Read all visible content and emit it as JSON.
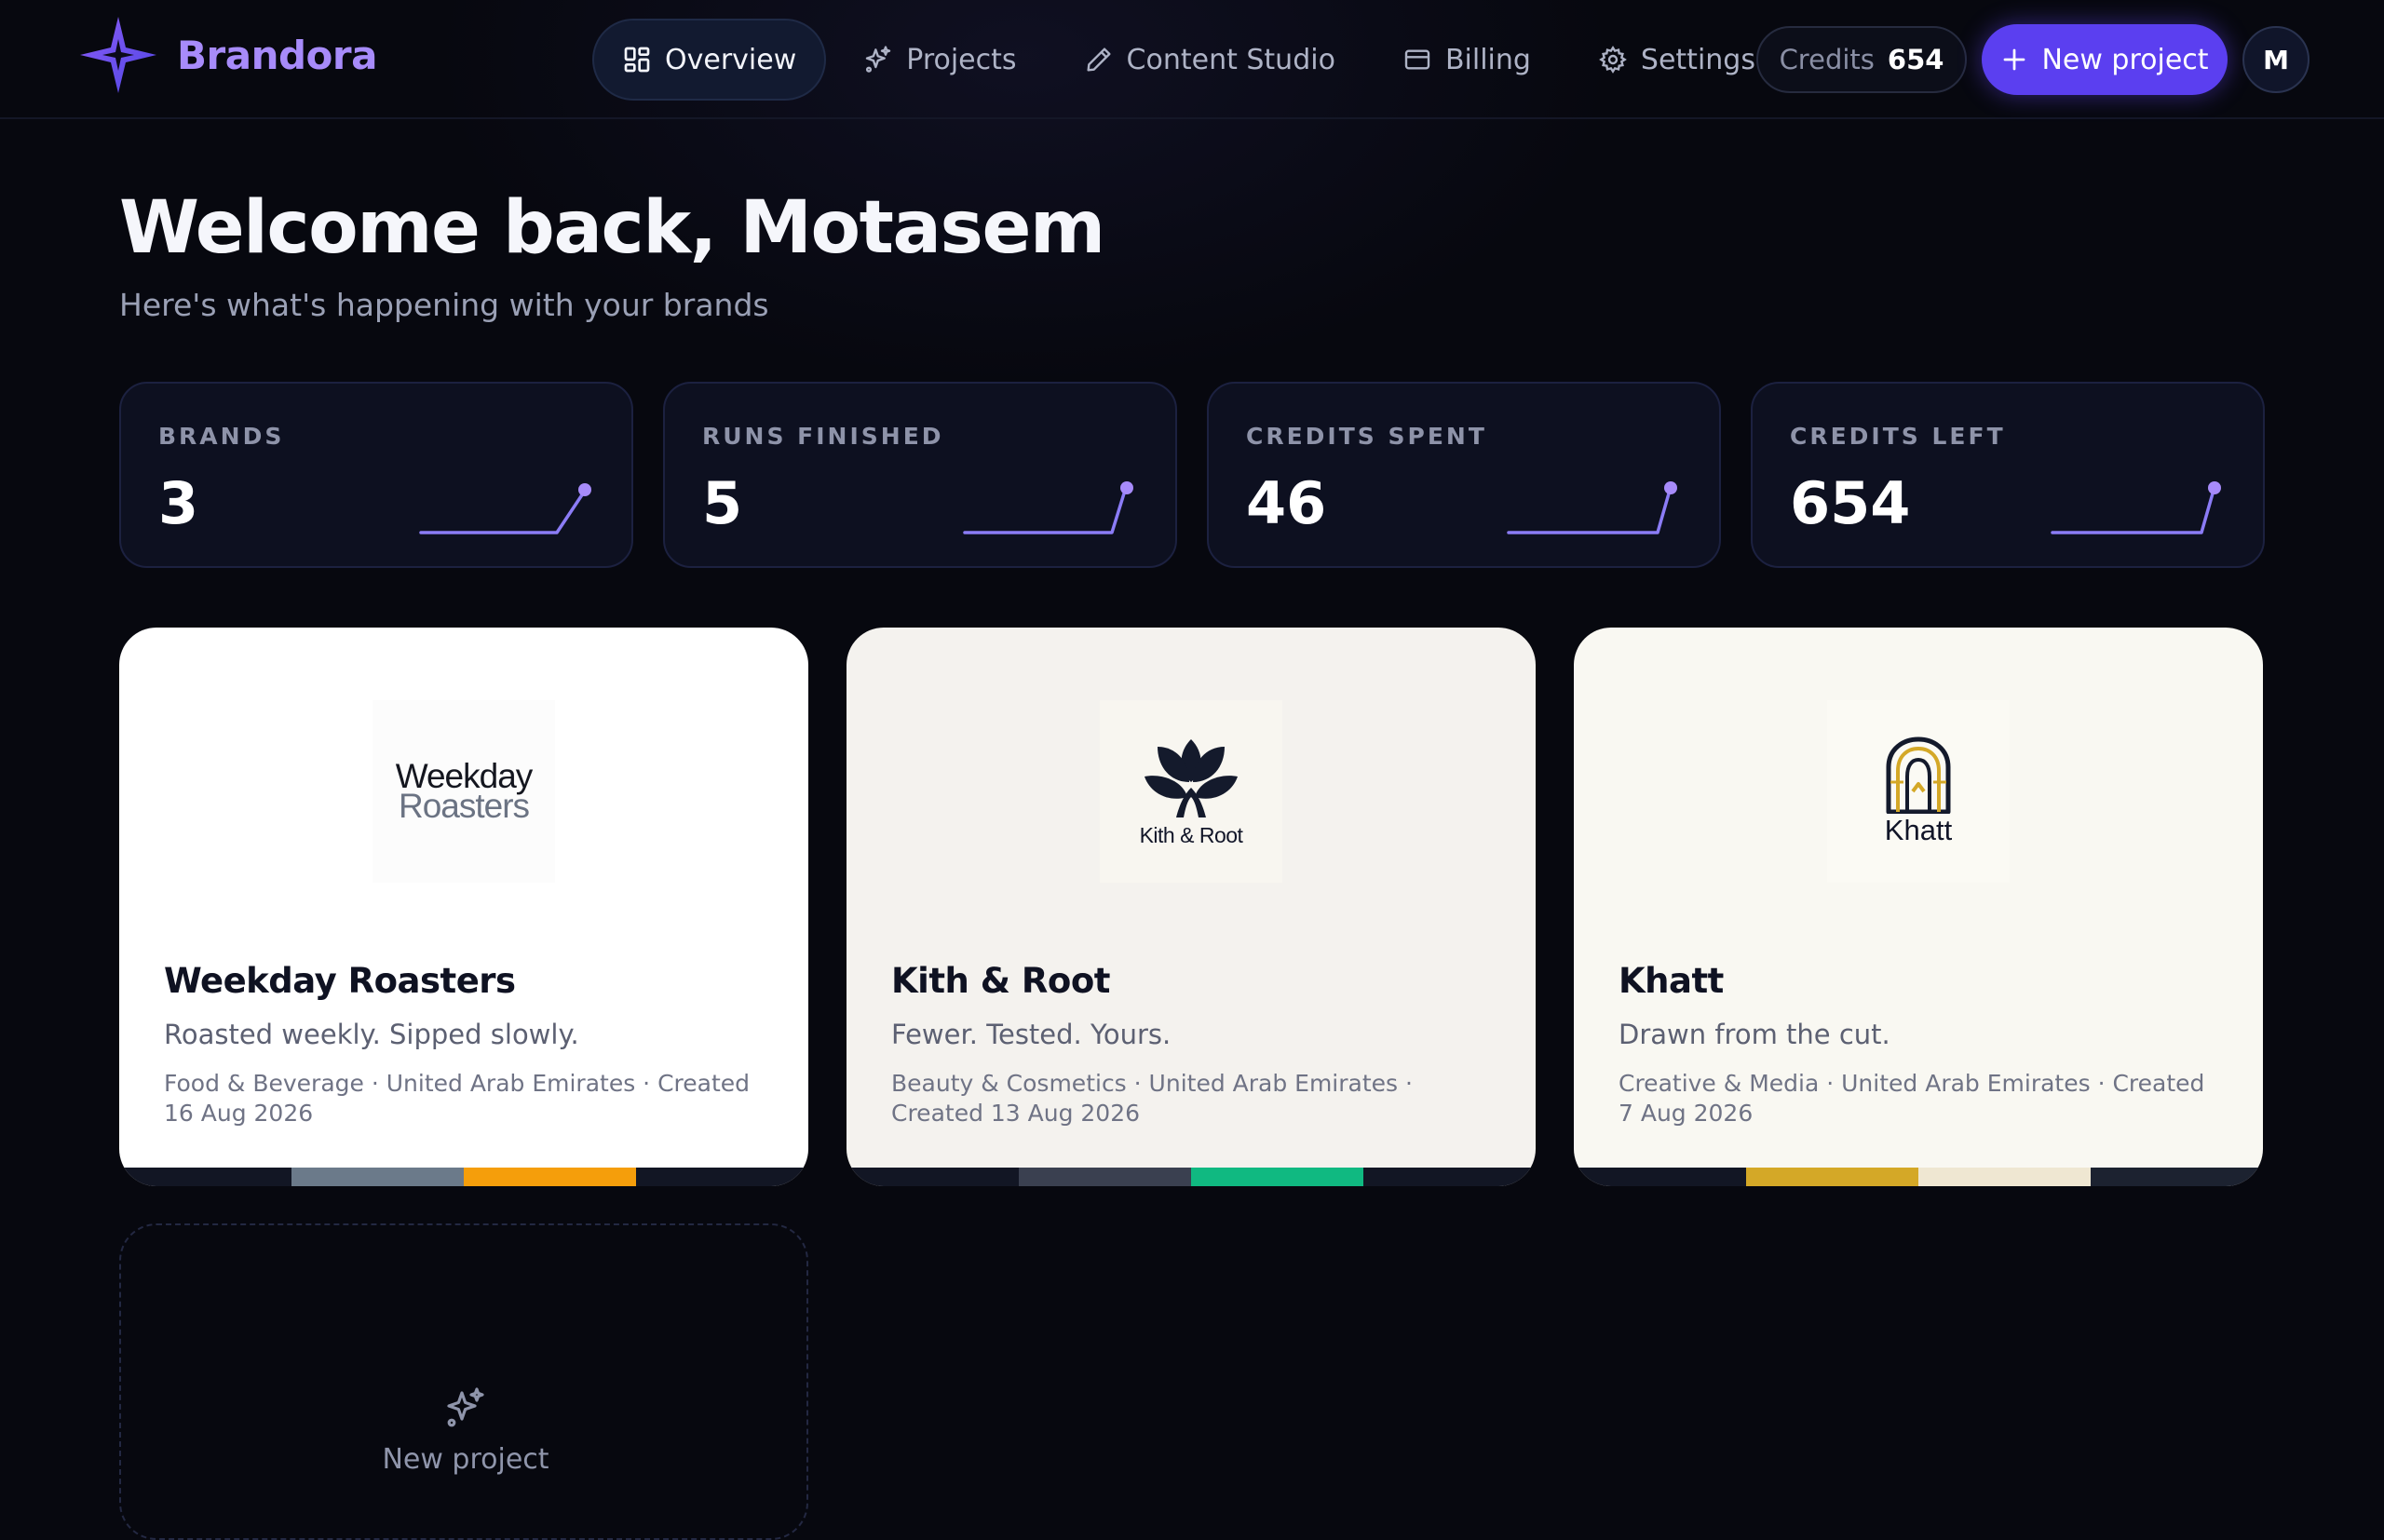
{
  "app": {
    "name": "Brandora"
  },
  "nav": {
    "items": [
      {
        "label": "Overview",
        "icon": "grid-icon",
        "active": true
      },
      {
        "label": "Projects",
        "icon": "sparkles-icon",
        "active": false
      },
      {
        "label": "Content Studio",
        "icon": "pencil-icon",
        "active": false
      },
      {
        "label": "Billing",
        "icon": "card-icon",
        "active": false
      },
      {
        "label": "Settings",
        "icon": "gear-icon",
        "active": false
      }
    ]
  },
  "header": {
    "credits_label": "Credits",
    "credits_value": "654",
    "new_project_label": "New project",
    "avatar_initial": "M"
  },
  "welcome": {
    "title": "Welcome back, Motasem",
    "subtitle": "Here's what's happening with your brands"
  },
  "stats": [
    {
      "label": "BRANDS",
      "value": "3"
    },
    {
      "label": "RUNS FINISHED",
      "value": "5"
    },
    {
      "label": "CREDITS SPENT",
      "value": "46"
    },
    {
      "label": "CREDITS LEFT",
      "value": "654"
    }
  ],
  "brands": [
    {
      "name": "Weekday Roasters",
      "tagline": "Roasted weekly. Sipped slowly.",
      "meta": "Food & Beverage · United Arab Emirates · Created 16 Aug 2026",
      "logo_line1": "Weekday",
      "logo_line2": "Roasters",
      "card_bg": "#ffffff",
      "palette": [
        "#121624",
        "#6b7a8a",
        "#f59e0b",
        "#121624"
      ]
    },
    {
      "name": "Kith & Root",
      "tagline": "Fewer. Tested. Yours.",
      "meta": "Beauty & Cosmetics · United Arab Emirates · Created 13 Aug 2026",
      "logo_caption": "Kith & Root",
      "card_bg": "#f4f2ee",
      "palette": [
        "#121624",
        "#3a4050",
        "#10b981",
        "#121624"
      ]
    },
    {
      "name": "Khatt",
      "tagline": "Drawn from the cut.",
      "meta": "Creative & Media · United Arab Emirates · Created 7 Aug 2026",
      "logo_caption": "Khatt",
      "card_bg": "#f9f8f2",
      "palette": [
        "#121624",
        "#d4a827",
        "#efe7d2",
        "#1c2230"
      ]
    }
  ],
  "new_project_card": {
    "label": "New project",
    "icon": "sparkles-icon"
  },
  "colors": {
    "accent": "#a78bfa",
    "primary_button": "#5b3ff0",
    "background": "#07080f",
    "sparkline": "#8b7cf6"
  }
}
